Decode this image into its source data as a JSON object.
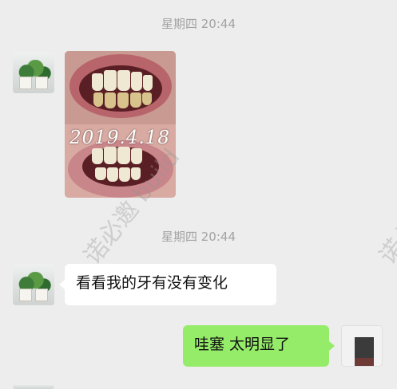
{
  "messages": {
    "timestamp_1": "星期四 20:44",
    "timestamp_2": "星期四 20:44",
    "photo_date_text": "2019.4.18",
    "incoming_text": "看看我的牙有没有变化",
    "outgoing_text": "哇塞 太明显了"
  },
  "watermark": {
    "text": "诺必邀 build"
  },
  "colors": {
    "background": "#ededed",
    "incoming_bubble": "#ffffff",
    "outgoing_bubble": "#95ec69",
    "timestamp": "#a3a3a3"
  },
  "icons": {
    "contact_avatar": "plant-photo-avatar",
    "self_avatar": "abstract-square-avatar"
  }
}
